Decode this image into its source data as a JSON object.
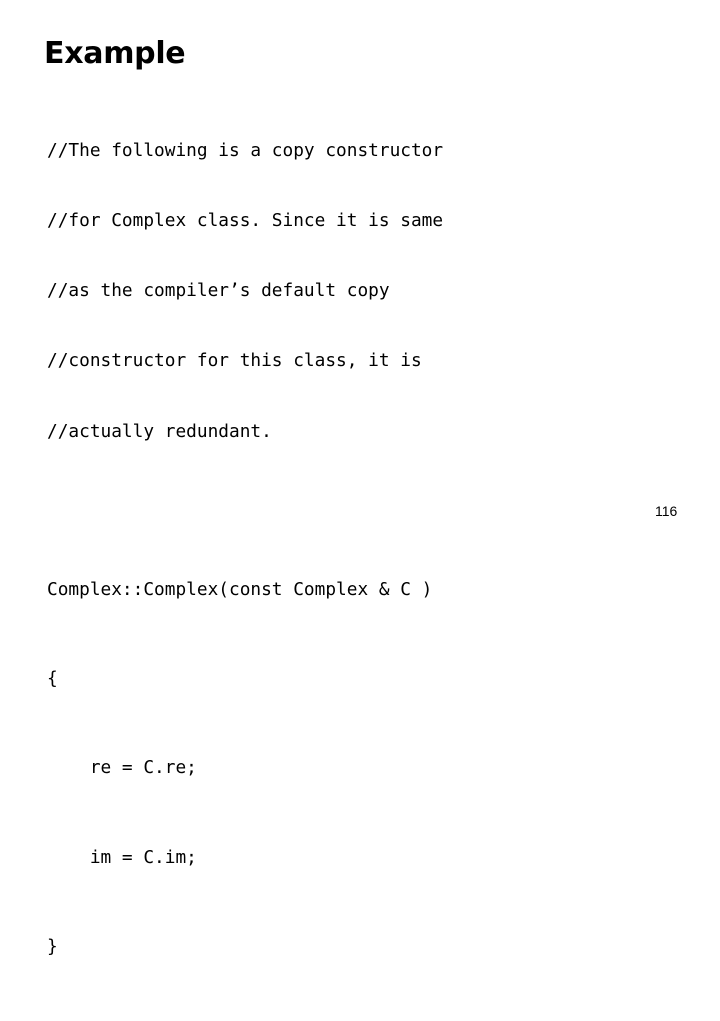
{
  "slide": {
    "title": "Example",
    "page_number": "116",
    "background_color": "#ffffff",
    "text_color": "#000000"
  },
  "comment_block": {
    "lines": [
      "//The following is a copy constructor",
      "//for Complex class. Since it is same",
      "//as the compiler’s default copy",
      "//constructor for this class, it is",
      "//actually redundant."
    ]
  },
  "code_block": {
    "lines": [
      "Complex::Complex(const Complex & C )",
      "{",
      "    re = C.re;",
      "    im = C.im;",
      "}"
    ]
  }
}
